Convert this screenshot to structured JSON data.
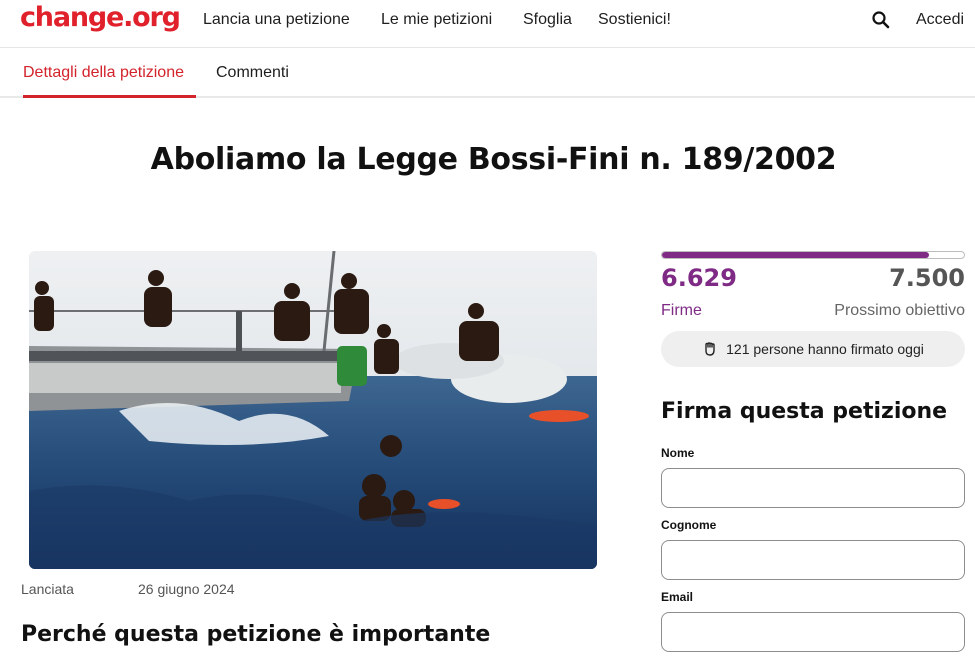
{
  "header": {
    "logo": "change.org",
    "nav": [
      "Lancia una petizione",
      "Le mie petizioni",
      "Sfoglia",
      "Sostienici!"
    ],
    "login": "Accedi",
    "search_icon": "search-icon"
  },
  "tabs": [
    "Dettagli della petizione",
    "Commenti"
  ],
  "petition": {
    "title": "Aboliamo la Legge Bossi-Fini n. 189/2002",
    "launched_label": "Lanciata",
    "launched_date": "26 giugno 2024",
    "why_heading": "Perché questa petizione è importante"
  },
  "stats": {
    "signatures": "6.629",
    "signatures_label": "Firme",
    "goal": "7.500",
    "goal_label": "Prossimo obiettivo",
    "progress_fraction": 0.884,
    "today_text": "121 persone hanno firmato oggi"
  },
  "form": {
    "heading": "Firma questa petizione",
    "fields": [
      {
        "label": "Nome",
        "value": ""
      },
      {
        "label": "Cognome",
        "value": ""
      },
      {
        "label": "Email",
        "value": ""
      }
    ]
  },
  "colors": {
    "brand": "#e0202a",
    "accent": "#7f2b86"
  }
}
